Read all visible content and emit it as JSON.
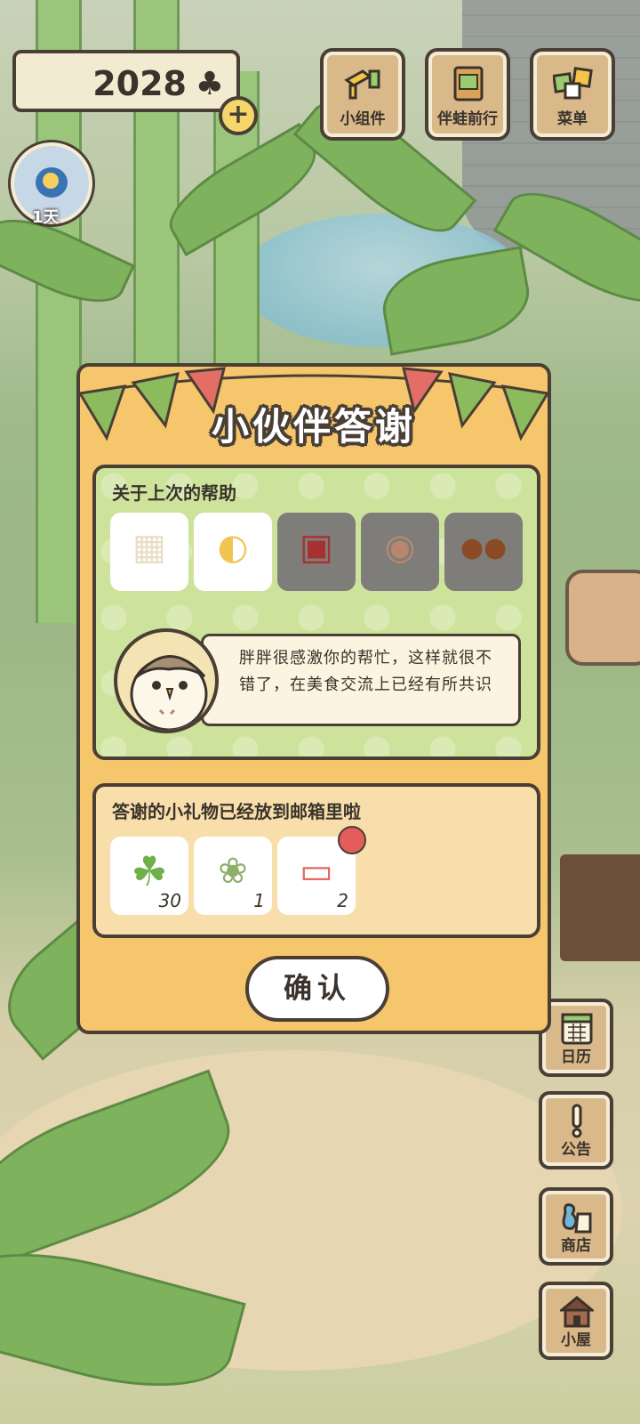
{
  "hud": {
    "clover_count": "2028",
    "clover_icon": "clover-icon",
    "add_label": "+",
    "avatar_label": "1天"
  },
  "top_buttons": [
    {
      "label": "小组件",
      "icon": "widget-icon"
    },
    {
      "label": "伴蛙前行",
      "icon": "map-icon"
    },
    {
      "label": "菜单",
      "icon": "menu-icon"
    }
  ],
  "side_buttons": [
    {
      "label": "日历",
      "icon": "calendar-icon"
    },
    {
      "label": "公告",
      "icon": "notice-icon"
    },
    {
      "label": "商店",
      "icon": "shop-icon"
    },
    {
      "label": "小屋",
      "icon": "house-icon"
    }
  ],
  "dialog": {
    "title": "小伙伴答谢",
    "help_section": {
      "title": "关于上次的帮助",
      "items": [
        {
          "icon": "nougat-icon",
          "glyph": "▦",
          "style": "white"
        },
        {
          "icon": "cheese-icon",
          "glyph": "◐",
          "style": "white"
        },
        {
          "icon": "gift-box-icon",
          "glyph": "▣",
          "style": "gray"
        },
        {
          "icon": "mooncake-icon",
          "glyph": "◉",
          "style": "gray"
        },
        {
          "icon": "chestnut-icon",
          "glyph": "●●",
          "style": "gray"
        }
      ],
      "message": "胖胖很感激你的帮忙，这样就很不错了，在美食交流上已经有所共识"
    },
    "gift_section": {
      "title": "答谢的小礼物已经放到邮箱里啦",
      "items": [
        {
          "icon": "clover-icon",
          "glyph": "☘",
          "qty": "30"
        },
        {
          "icon": "herb-icon",
          "glyph": "❀",
          "qty": "1"
        },
        {
          "icon": "ticket-icon",
          "glyph": "▭",
          "qty": "2",
          "new_badge": true
        }
      ]
    },
    "confirm_label": "确认"
  }
}
